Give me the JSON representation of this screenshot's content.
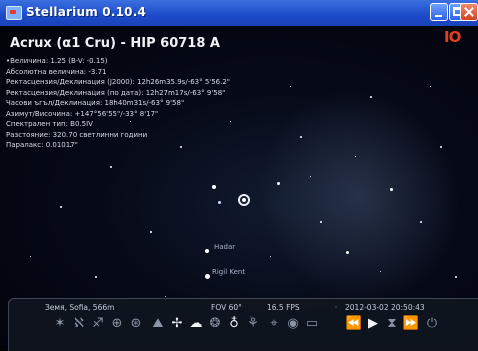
{
  "window": {
    "title": "Stellarium 0.10.4",
    "corner_logo": "IO"
  },
  "object": {
    "title": "Acrux (α1 Cru) - HIP 60718 A",
    "info_lines": [
      "•Величина: 1.25 (B-V: -0.15)",
      "Абсолютна величина: -3.71",
      "Ректасцензия/Деклинация (J2000): 12h26m35.9s/-63° 5'56.2\"",
      "Ректасцензия/Деклинация (по дата): 12h27m17s/-63° 9'58\"",
      "Часови ъгъл/Деклинация: 18h40m31s/-63° 9'58\"",
      "Азимут/Височина: +147°56'55\"/-33° 8'17\"",
      "Спектрален тип: B0.5IV",
      "Разстояние: 320.70 светлинни години",
      "Паралакс: 0.01017\""
    ]
  },
  "star_labels": [
    "Hadar",
    "Rigil Kent"
  ],
  "status": {
    "location": "Земя, Sofia, 566m",
    "fov": "FOV 60°",
    "fps": "16.5 FPS",
    "datetime": "2012-03-02   20:50:43"
  },
  "toolbar": {
    "buttons": [
      {
        "name": "constellation-lines-icon",
        "glyph": "✶",
        "active": false
      },
      {
        "name": "constellation-labels-icon",
        "glyph": "ℵ",
        "active": false
      },
      {
        "name": "constellation-art-icon",
        "glyph": "♐",
        "active": false
      },
      {
        "name": "equatorial-grid-icon",
        "glyph": "⊕",
        "active": false
      },
      {
        "name": "azimuthal-grid-icon",
        "glyph": "⊛",
        "active": false
      },
      {
        "name": "ground-icon",
        "glyph": "⛰",
        "active": false
      },
      {
        "name": "cardinal-points-icon",
        "glyph": "✢",
        "active": true
      },
      {
        "name": "atmosphere-icon",
        "glyph": "☁",
        "active": true
      },
      {
        "name": "nebulae-icon",
        "glyph": "❂",
        "active": false
      },
      {
        "name": "planet-labels-icon",
        "glyph": "♁",
        "active": true
      },
      {
        "name": "equatorial-mount-icon",
        "glyph": "⚘",
        "active": false
      },
      {
        "name": "center-object-icon",
        "glyph": "⌖",
        "active": false
      },
      {
        "name": "night-mode-icon",
        "glyph": "◉",
        "active": false
      },
      {
        "name": "fullscreen-icon",
        "glyph": "▭",
        "active": false
      },
      {
        "name": "rewind-icon",
        "glyph": "⏪",
        "active": false
      },
      {
        "name": "play-icon",
        "glyph": "▶",
        "active": true
      },
      {
        "name": "now-icon",
        "glyph": "⧗",
        "active": false
      },
      {
        "name": "fast-forward-icon",
        "glyph": "⏩",
        "active": false
      },
      {
        "name": "quit-icon",
        "glyph": "⏻",
        "active": false
      }
    ]
  }
}
